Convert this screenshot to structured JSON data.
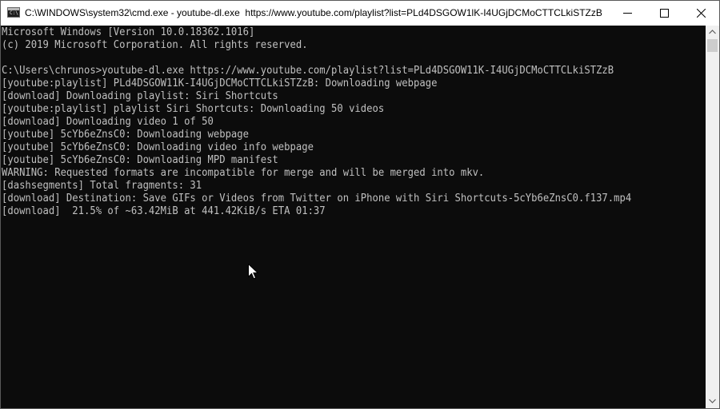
{
  "window": {
    "title": "C:\\WINDOWS\\system32\\cmd.exe - youtube-dl.exe  https://www.youtube.com/playlist?list=PLd4DSGOW1lK-I4UGjDCMoCTTCLkiSTZzB",
    "icon": "cmd-app-icon",
    "icon_label": "C:\\"
  },
  "controls": {
    "minimize_icon": "minimize-icon",
    "maximize_icon": "maximize-icon",
    "close_icon": "close-icon"
  },
  "console": {
    "background": "#0c0c0c",
    "foreground": "#c0c0c0",
    "lines": [
      "Microsoft Windows [Version 10.0.18362.1016]",
      "(c) 2019 Microsoft Corporation. All rights reserved.",
      "",
      "C:\\Users\\chrunos>youtube-dl.exe https://www.youtube.com/playlist?list=PLd4DSGOW11K-I4UGjDCMoCTTCLkiSTZzB",
      "[youtube:playlist] PLd4DSGOW11K-I4UGjDCMoCTTCLkiSTZzB: Downloading webpage",
      "[download] Downloading playlist: Siri Shortcuts",
      "[youtube:playlist] playlist Siri Shortcuts: Downloading 50 videos",
      "[download] Downloading video 1 of 50",
      "[youtube] 5cYb6eZnsC0: Downloading webpage",
      "[youtube] 5cYb6eZnsC0: Downloading video info webpage",
      "[youtube] 5cYb6eZnsC0: Downloading MPD manifest",
      "WARNING: Requested formats are incompatible for merge and will be merged into mkv.",
      "[dashsegments] Total fragments: 31",
      "[download] Destination: Save GIFs or Videos from Twitter on iPhone with Siri Shortcuts-5cYb6eZnsC0.f137.mp4",
      "[download]  21.5% of ~63.42MiB at 441.42KiB/s ETA 01:37"
    ]
  },
  "mouse_pointer": "arrow-cursor-icon",
  "scrollbar": {
    "up_icon": "scroll-up-icon",
    "down_icon": "scroll-down-icon"
  }
}
